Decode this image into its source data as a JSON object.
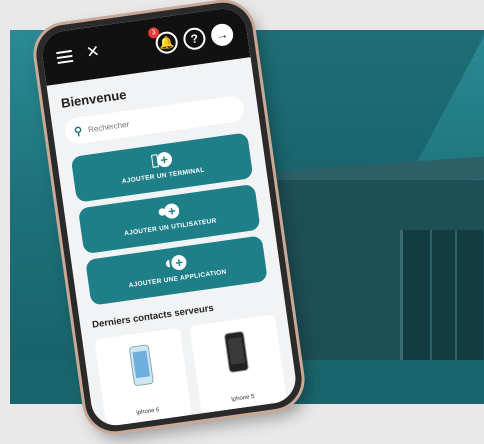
{
  "header": {
    "notification_count": "3",
    "help_symbol": "?",
    "logout_symbol": "→"
  },
  "main": {
    "welcome_title": "Bienvenue",
    "search_placeholder": "Rechercher",
    "actions": [
      {
        "label": "AJOUTER UN TERMINAL",
        "icon": "phone-add-icon"
      },
      {
        "label": "AJOUTER UN UTILISATEUR",
        "icon": "user-add-icon"
      },
      {
        "label": "AJOUTER UNE APPLICATION",
        "icon": "app-add-icon"
      }
    ],
    "recent_title": "Derniers contacts serveurs",
    "recent_devices": [
      {
        "name": "Iphone 6"
      },
      {
        "name": "Iphone 5"
      }
    ]
  },
  "colors": {
    "accent": "#1f7f89",
    "topbar": "#111111",
    "background_teal": "#1b6f77",
    "badge": "#e53935"
  }
}
